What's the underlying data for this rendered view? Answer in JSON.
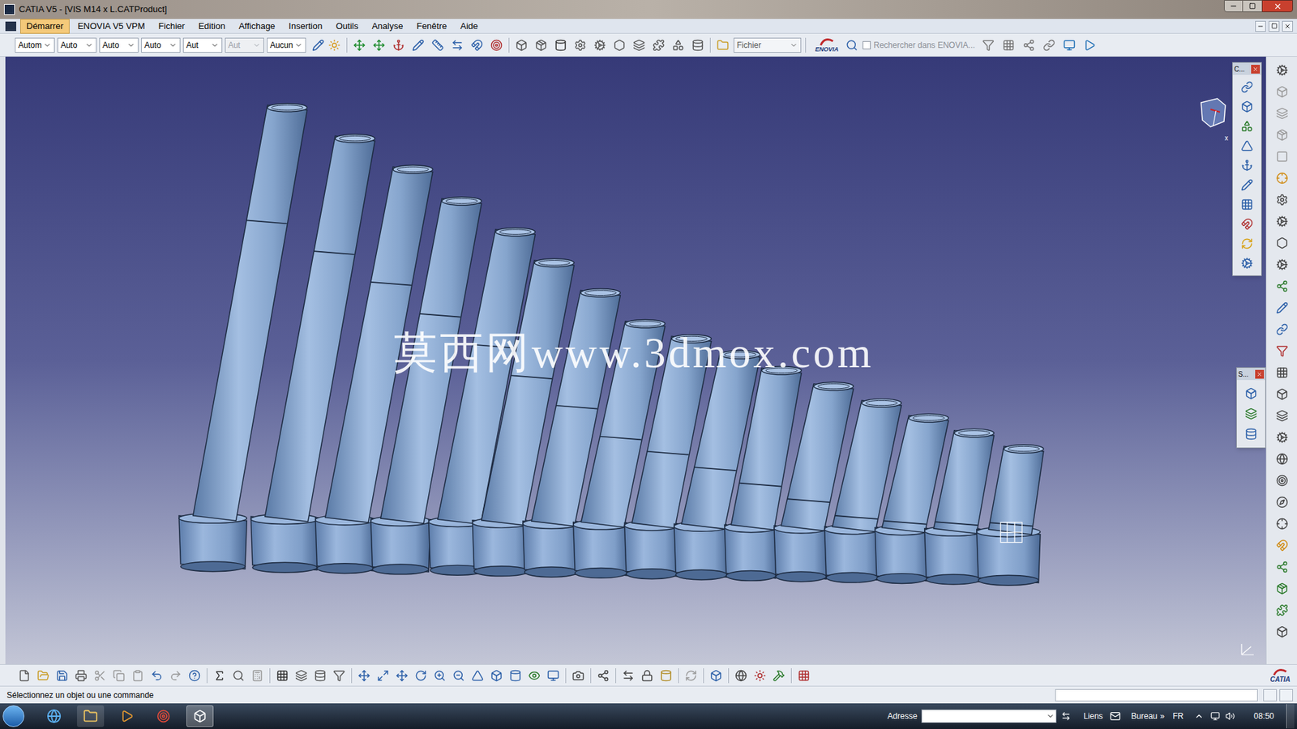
{
  "window": {
    "title": "CATIA V5 - [VIS M14 x L.CATProduct]"
  },
  "menu": [
    {
      "label": "Démarrer",
      "selected": true
    },
    {
      "label": "ENOVIA V5 VPM",
      "selected": false
    },
    {
      "label": "Fichier",
      "selected": false
    },
    {
      "label": "Edition",
      "selected": false
    },
    {
      "label": "Affichage",
      "selected": false
    },
    {
      "label": "Insertion",
      "selected": false
    },
    {
      "label": "Outils",
      "selected": false
    },
    {
      "label": "Analyse",
      "selected": false
    },
    {
      "label": "Fenêtre",
      "selected": false
    },
    {
      "label": "Aide",
      "selected": false
    }
  ],
  "toolbar": {
    "dropdowns": [
      {
        "value": "Autom",
        "disabled": false
      },
      {
        "value": "Auto",
        "disabled": false
      },
      {
        "value": "Auto",
        "disabled": false
      },
      {
        "value": "Auto",
        "disabled": false
      },
      {
        "value": "Aut",
        "disabled": false
      },
      {
        "value": "Aut",
        "disabled": true
      },
      {
        "value": "Aucun",
        "disabled": false
      }
    ],
    "file_dropdown": "Fichier",
    "enovia_logo": "ENOVIA",
    "search": {
      "label": "Rechercher dans ENOVIA...",
      "checked": false,
      "disabled": true
    }
  },
  "viewport": {
    "watermark": "莫西网www.3dmox.com",
    "compass_axis": "x"
  },
  "floating_toolbars": [
    {
      "title": "C..."
    },
    {
      "title": "S..."
    }
  ],
  "status_bar": {
    "message": "Sélectionnez un objet ou une commande"
  },
  "catia_logo": "CATIA",
  "taskbar": {
    "address_label": "Adresse",
    "links": "Liens",
    "desktop": "Bureau",
    "more": "»",
    "language": "FR",
    "time": "08:50"
  }
}
